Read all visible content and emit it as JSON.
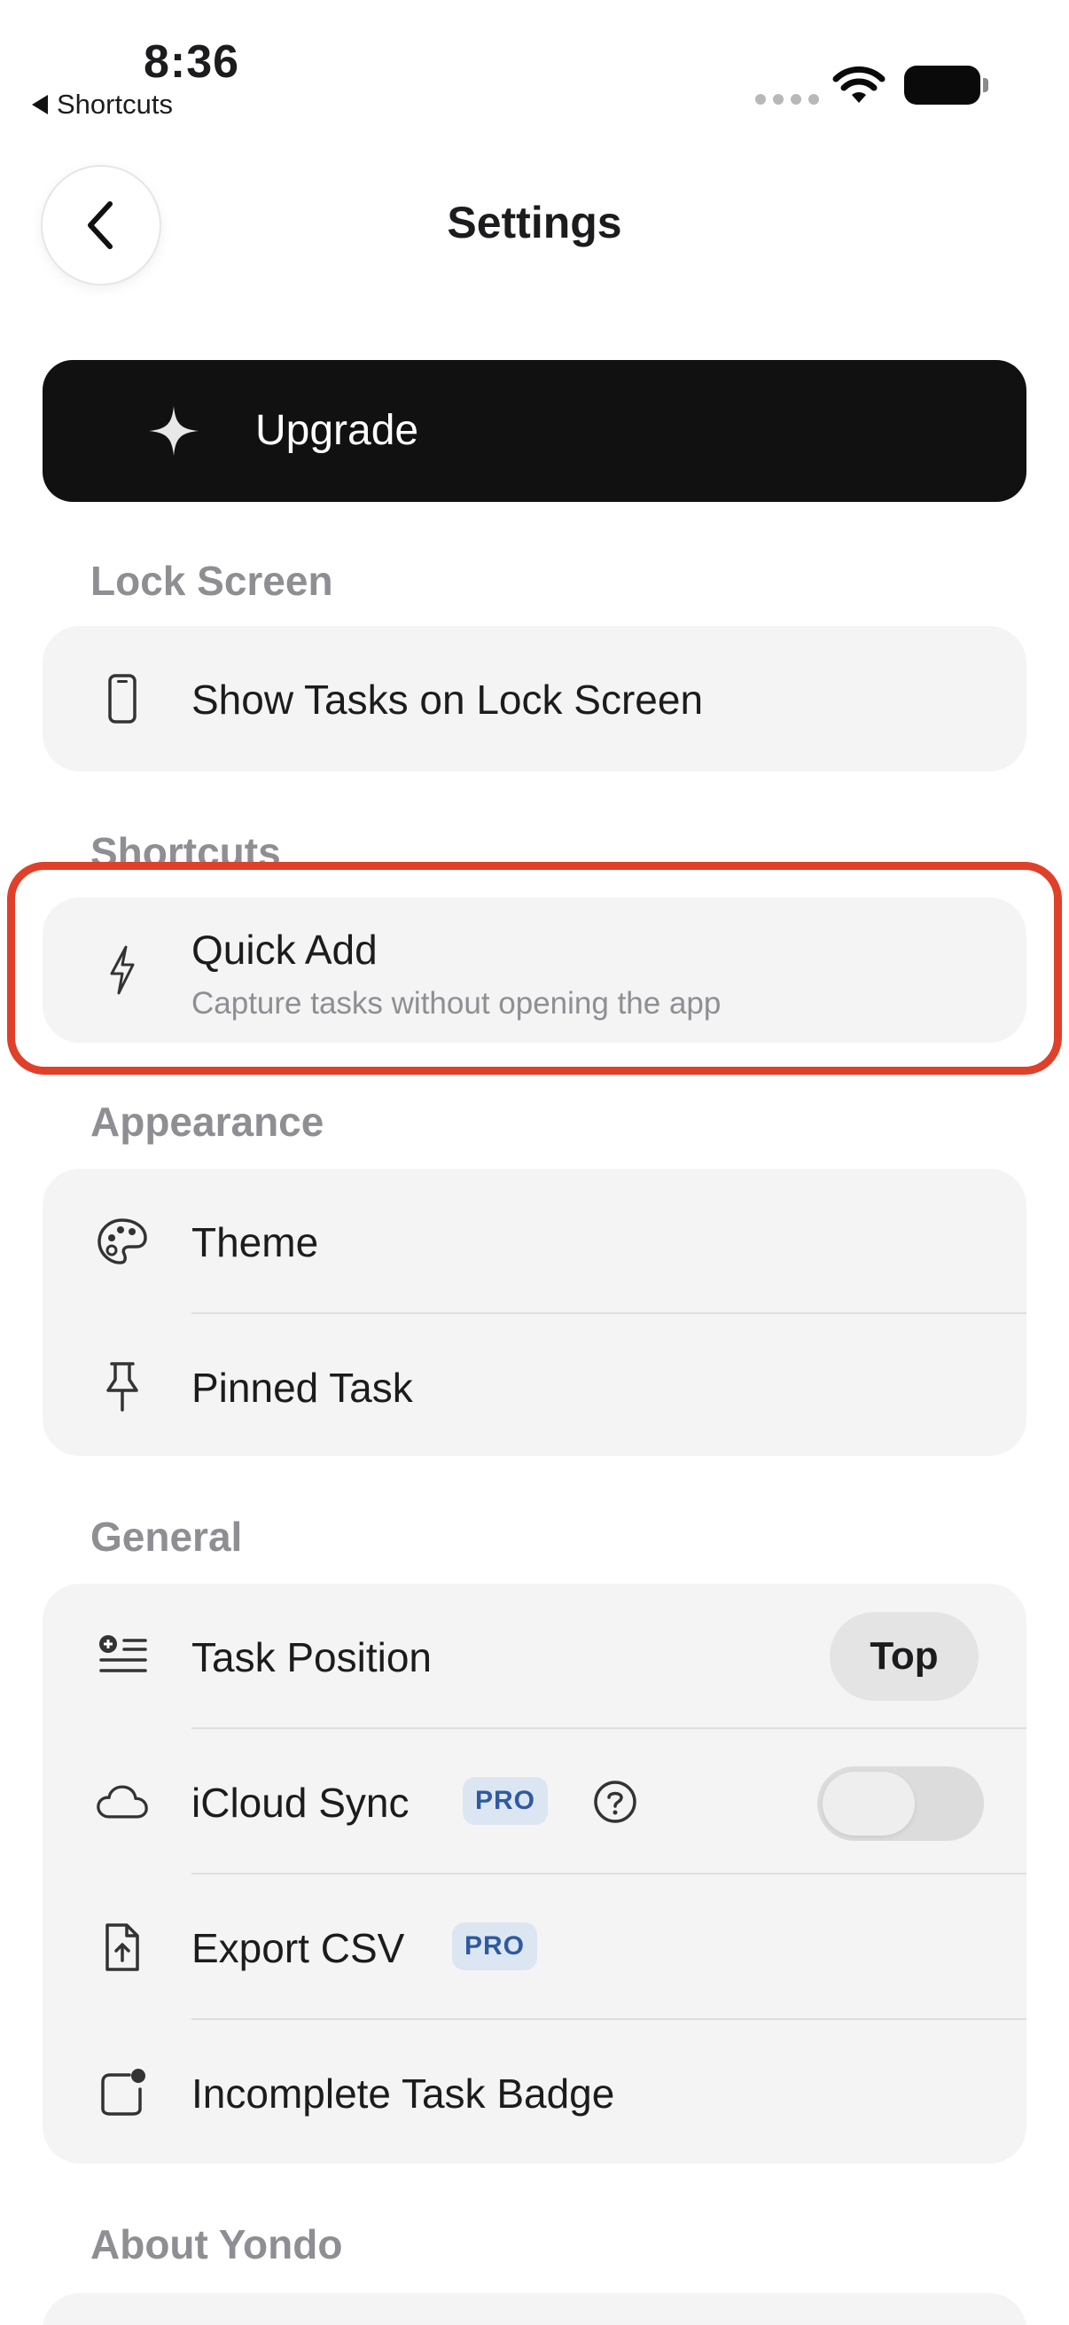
{
  "status_bar": {
    "time": "8:36",
    "back_app": "Shortcuts"
  },
  "header": {
    "title": "Settings"
  },
  "upgrade": {
    "label": "Upgrade"
  },
  "sections": {
    "lock_screen": {
      "title": "Lock Screen",
      "show_tasks": "Show Tasks on Lock Screen"
    },
    "shortcuts": {
      "title": "Shortcuts",
      "quick_add": "Quick Add",
      "quick_add_subtitle": "Capture tasks without opening the app"
    },
    "appearance": {
      "title": "Appearance",
      "theme": "Theme",
      "pinned_task": "Pinned Task"
    },
    "general": {
      "title": "General",
      "task_position": "Task Position",
      "task_position_value": "Top",
      "icloud_sync": "iCloud Sync",
      "icloud_sync_enabled": false,
      "export_csv": "Export CSV",
      "pro_badge": "PRO",
      "incomplete_badge": "Incomplete Task Badge"
    },
    "about": {
      "title": "About Yondo"
    }
  },
  "colors": {
    "highlight": "#e0402a",
    "upgrade_bg": "#111111",
    "pro_badge_bg": "#dce6f2",
    "pro_badge_text": "#2f5aa0"
  }
}
